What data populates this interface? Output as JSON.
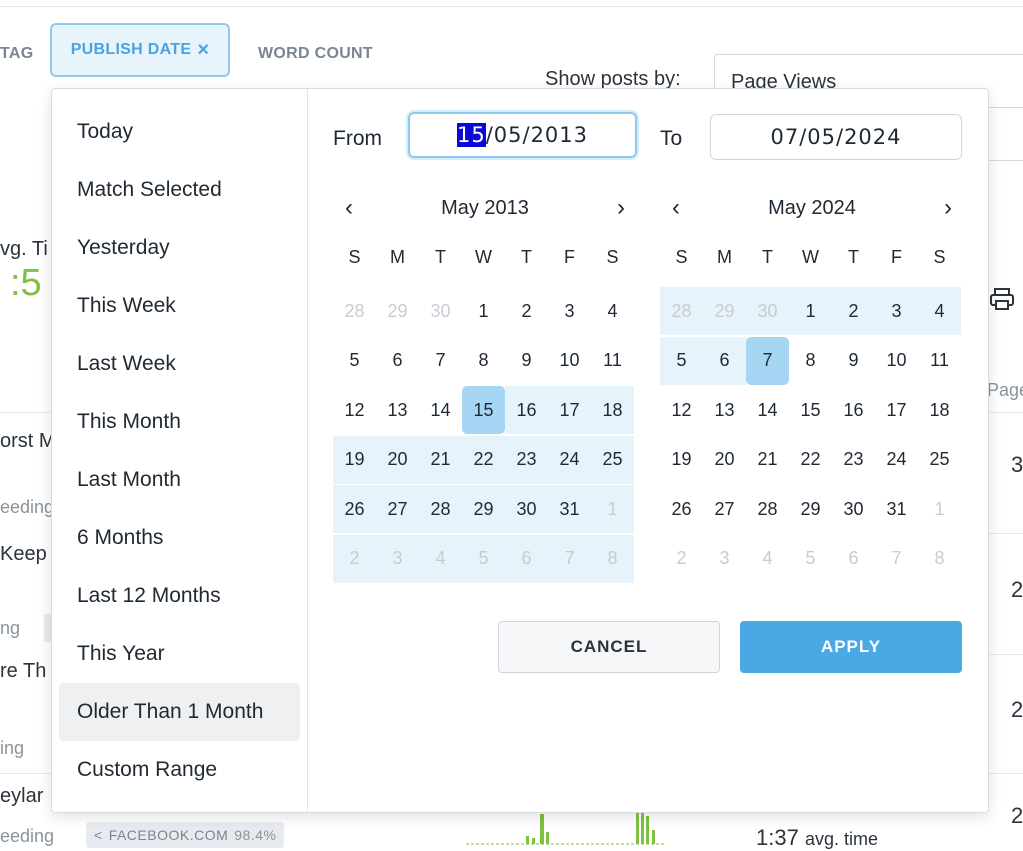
{
  "filters": {
    "tag_partial": "TAG",
    "publish_date": "PUBLISH DATE",
    "close_glyph": "×",
    "word_count": "WORD COUNT"
  },
  "show_by": {
    "label": "Show posts by:",
    "value": "Page Views"
  },
  "background": {
    "avg_partial": "vg. Ti",
    "big_value": ":5",
    "page_partial": "Page",
    "rows": [
      {
        "title_partial": "orst M",
        "sub_partial": "eeding"
      },
      {
        "title_partial": " Keep",
        "sub_partial": "ng"
      },
      {
        "title_partial": "re Th",
        "sub_partial": "ing"
      },
      {
        "title_partial": "eylar",
        "sub_partial": "eeding"
      }
    ],
    "right_nums": [
      "3",
      "2",
      "2",
      "2"
    ],
    "referrer": {
      "name": "FACEBOOK.COM",
      "pct": "98.4%"
    },
    "avg_time": {
      "value": "1:37",
      "suffix": "avg. time"
    },
    "accent_green": "#7fc241",
    "icons": [
      "print-icon",
      "share-icon"
    ]
  },
  "date_picker": {
    "ranges": [
      "Today",
      "Match Selected",
      "Yesterday",
      "This Week",
      "Last Week",
      "This Month",
      "Last Month",
      "6 Months",
      "Last 12 Months",
      "This Year",
      "Older Than 1 Month",
      "Custom Range"
    ],
    "highlighted_range": "Older Than 1 Month",
    "from_label": "From",
    "from_value": {
      "selected_part": "15",
      "rest": "/05/2013"
    },
    "to_label": "To",
    "to_value": "07/05/2024",
    "weekdays": [
      "S",
      "M",
      "T",
      "W",
      "T",
      "F",
      "S"
    ],
    "calendars": [
      {
        "title": "May 2013",
        "prev": "‹",
        "next": "›",
        "weeks": [
          [
            "28",
            "29",
            "30",
            "1",
            "2",
            "3",
            "4"
          ],
          [
            "5",
            "6",
            "7",
            "8",
            "9",
            "10",
            "11"
          ],
          [
            "12",
            "13",
            "14",
            "15",
            "16",
            "17",
            "18"
          ],
          [
            "19",
            "20",
            "21",
            "22",
            "23",
            "24",
            "25"
          ],
          [
            "26",
            "27",
            "28",
            "29",
            "30",
            "31",
            "1"
          ],
          [
            "2",
            "3",
            "4",
            "5",
            "6",
            "7",
            "8"
          ]
        ]
      },
      {
        "title": "May 2024",
        "prev": "‹",
        "next": "›",
        "weeks": [
          [
            "28",
            "29",
            "30",
            "1",
            "2",
            "3",
            "4"
          ],
          [
            "5",
            "6",
            "7",
            "8",
            "9",
            "10",
            "11"
          ],
          [
            "12",
            "13",
            "14",
            "15",
            "16",
            "17",
            "18"
          ],
          [
            "19",
            "20",
            "21",
            "22",
            "23",
            "24",
            "25"
          ],
          [
            "26",
            "27",
            "28",
            "29",
            "30",
            "31",
            "1"
          ],
          [
            "2",
            "3",
            "4",
            "5",
            "6",
            "7",
            "8"
          ]
        ]
      }
    ],
    "range_color": "#e6f3fb",
    "endpoint_color": "#a6d6f4",
    "cancel_label": "CANCEL",
    "apply_label": "APPLY",
    "apply_color": "#4aa9e5"
  }
}
